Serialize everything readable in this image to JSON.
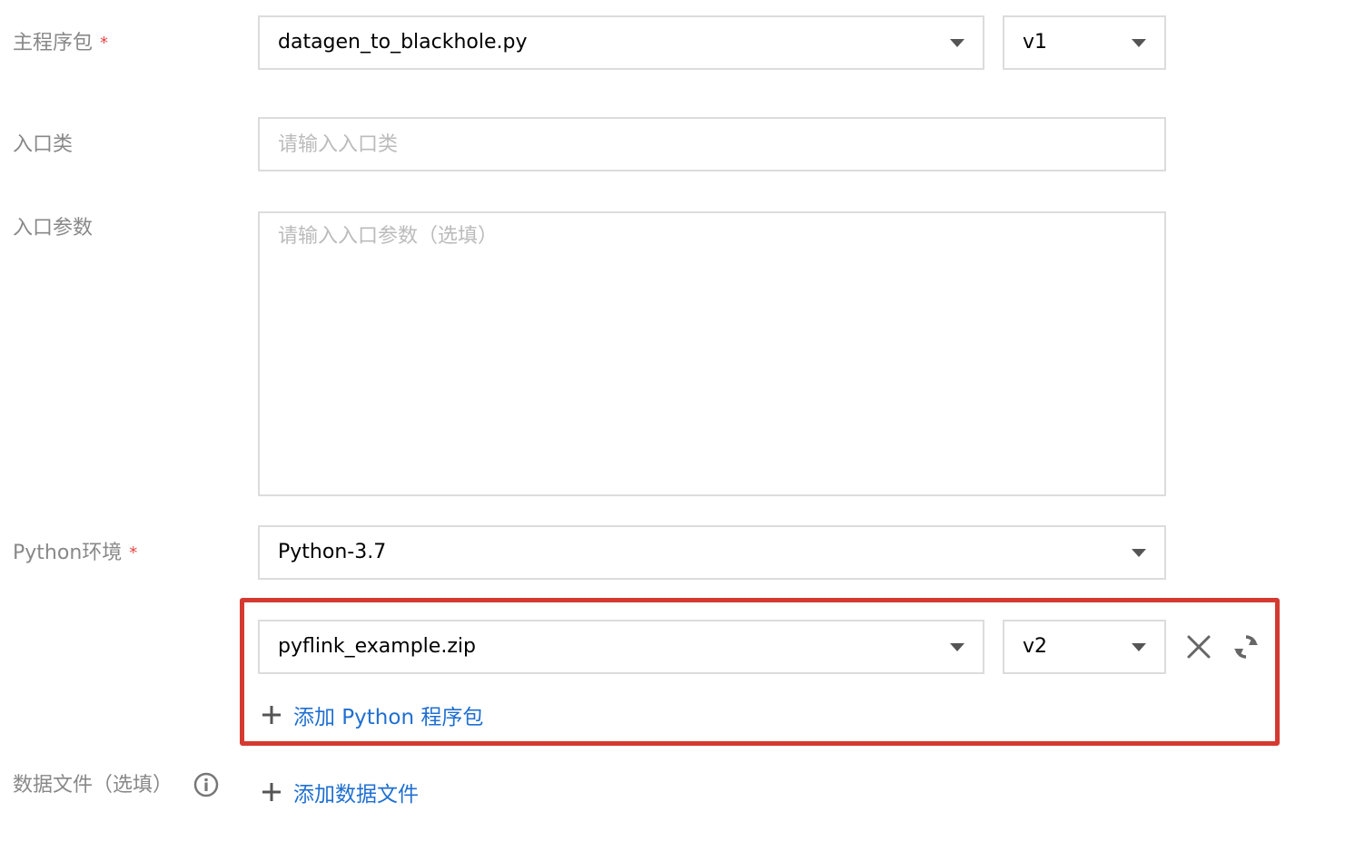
{
  "form": {
    "main_package": {
      "label": "主程序包",
      "required_mark": "*",
      "file_value": "datagen_to_blackhole.py",
      "version_value": "v1"
    },
    "entry_class": {
      "label": "入口类",
      "placeholder": "请输入入口类"
    },
    "entry_params": {
      "label": "入口参数",
      "placeholder": "请输入入口参数（选填）"
    },
    "python_env": {
      "label": "Python环境",
      "required_mark": "*",
      "value": "Python-3.7"
    },
    "python_package": {
      "file_value": "pyflink_example.zip",
      "version_value": "v2",
      "add_link": "添加 Python 程序包"
    },
    "data_files": {
      "label": "数据文件（选填）",
      "add_link": "添加数据文件"
    }
  },
  "icons": {
    "dropdown": "caret-down-icon",
    "remove": "close-icon",
    "refresh": "refresh-icon",
    "add": "plus-icon",
    "info": "info-icon"
  },
  "colors": {
    "required": "#e54545",
    "link": "#1f6fd1",
    "highlight_border": "#d43a30",
    "label": "#888888",
    "input_border": "#dcdcdc"
  }
}
